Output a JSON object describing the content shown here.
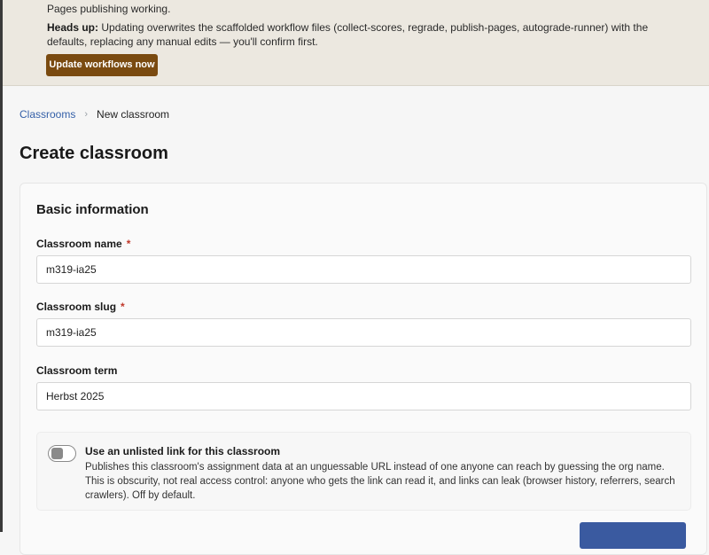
{
  "banner": {
    "line1": "Pages publishing working.",
    "heads_up_label": "Heads up:",
    "heads_up_text": "Updating overwrites the scaffolded workflow files (collect-scores, regrade, publish-pages, autograde-runner) with the defaults, replacing any manual edits — you'll confirm first.",
    "update_button": "Update workflows now"
  },
  "breadcrumb": {
    "parent": "Classrooms",
    "separator": "›",
    "current": "New classroom"
  },
  "page_title": "Create classroom",
  "form": {
    "section_title": "Basic information",
    "required_mark": "*",
    "name": {
      "label": "Classroom name",
      "value": "m319-ia25"
    },
    "slug": {
      "label": "Classroom slug",
      "value": "m319-ia25"
    },
    "term": {
      "label": "Classroom term",
      "value": "Herbst 2025"
    },
    "unlisted": {
      "title": "Use an unlisted link for this classroom",
      "description": "Publishes this classroom's assignment data at an unguessable URL instead of one anyone can reach by guessing the org name. This is obscurity, not real access control: anyone who gets the link can read it, and links can leak (browser history, referrers, search crawlers). Off by default.",
      "enabled": false
    },
    "submit_label": ""
  },
  "colors": {
    "accent": "#3a5aa0",
    "banner_button": "#7a4a10",
    "link": "#3560a8",
    "required": "#c0392b"
  }
}
